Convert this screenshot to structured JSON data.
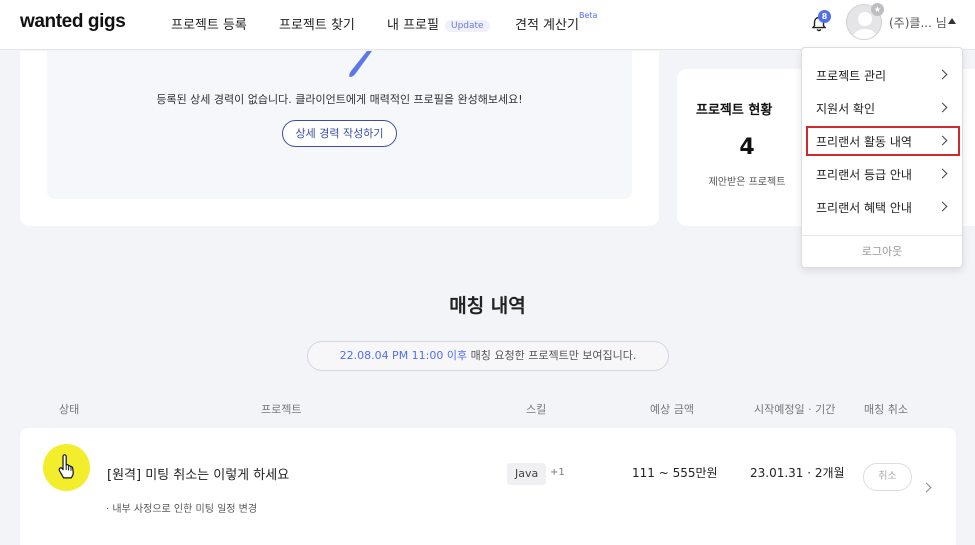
{
  "header": {
    "logo": "wanted gigs",
    "nav": [
      {
        "label": "프로젝트 등록"
      },
      {
        "label": "프로젝트 찾기"
      },
      {
        "label": "내 프로필",
        "badge": "Update"
      },
      {
        "label": "견적 계산기",
        "sup": "Beta"
      }
    ],
    "notification_count": "8",
    "user_name": "(주)클... 님",
    "avatar_icon": "user-avatar",
    "bell_icon": "bell-icon"
  },
  "profile_card": {
    "empty_message": "등록된 상세 경력이 없습니다. 클라이언트에게 매력적인 프로필을 완성해보세요!",
    "write_button": "상세 경력 작성하기"
  },
  "project_status": {
    "title": "프로젝트 현황",
    "count": "4",
    "count_label": "제안받은 프로젝트"
  },
  "dropdown": {
    "items": [
      {
        "label": "프로젝트 관리"
      },
      {
        "label": "지원서 확인"
      },
      {
        "label": "프리랜서 활동 내역"
      },
      {
        "label": "프리랜서 등급 안내"
      },
      {
        "label": "프리랜서 혜택 안내"
      }
    ],
    "logout": "로그아웃"
  },
  "matching": {
    "title": "매칭 내역",
    "notice_highlight": "22.08.04 PM 11:00 이후",
    "notice_rest": " 매칭 요청한 프로젝트만 보여집니다.",
    "columns": {
      "status": "상태",
      "project": "프로젝트",
      "skill": "스킬",
      "amount": "예상 금액",
      "period": "시작예정일 · 기간",
      "cancel": "매칭 취소"
    },
    "rows": [
      {
        "title": "[원격] 미팅 취소는 이렇게 하세요",
        "note": "· 내부 사정으로 인한 미팅 일정 변경",
        "skill": "Java",
        "skill_more": "+1",
        "amount": "111 ~ 555만원",
        "period": "23.01.31 · 2개월",
        "cancel_label": "취소"
      }
    ]
  },
  "colors": {
    "accent": "#4f6ef2",
    "highlight_border": "#d3272f",
    "cursor_highlight": "#f3ee2c"
  }
}
